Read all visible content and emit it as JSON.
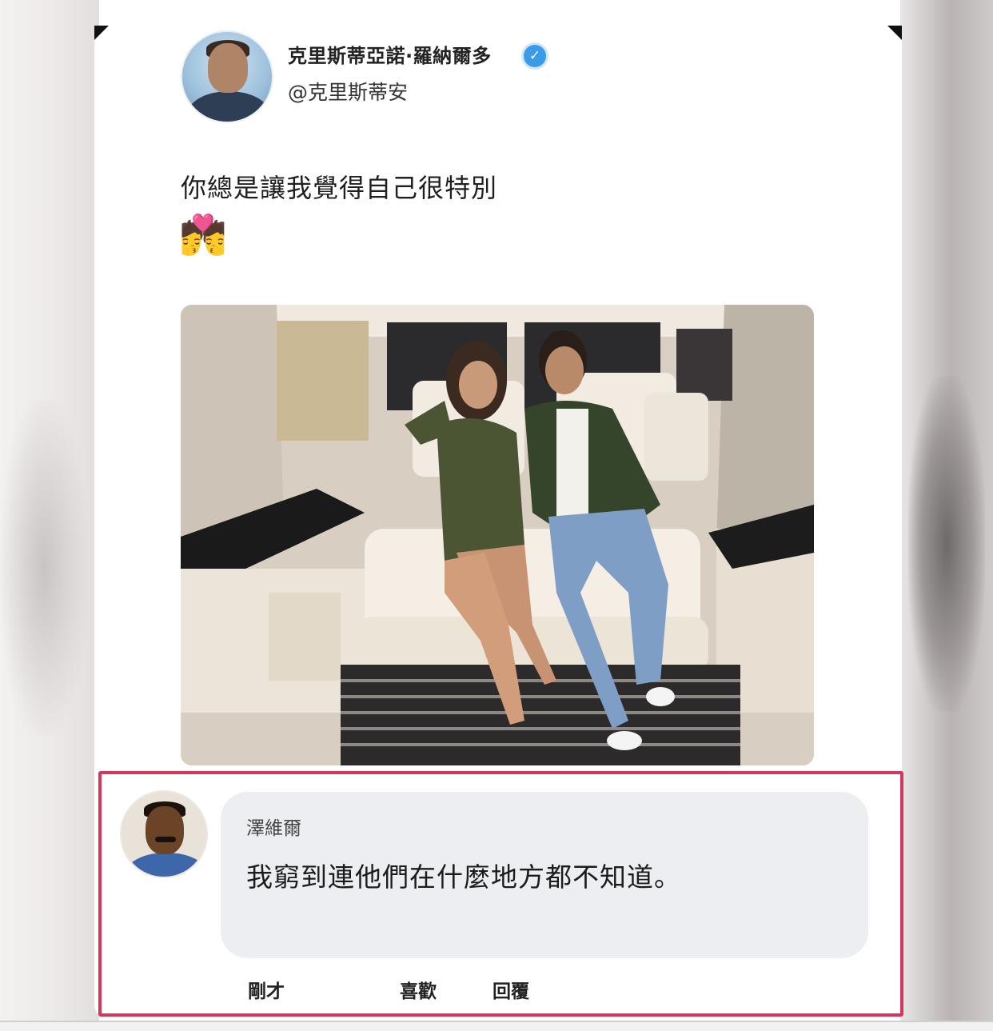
{
  "post": {
    "author_name": "克里斯蒂亞諾·羅納爾多",
    "author_handle": "@克里斯蒂安",
    "verified_icon": "✓",
    "text": "你總是讓我覺得自己很特別",
    "emoji": "💏",
    "avatar_icon": "profile-photo",
    "photo_icon": "couple-in-van-photo"
  },
  "comment": {
    "author_name": "澤維爾",
    "text": "我窮到連他們在什麼地方都不知道。",
    "timestamp": "剛才",
    "like_label": "喜歡",
    "reply_label": "回覆",
    "highlight_color": "#d4365c"
  },
  "colors": {
    "verified_badge": "#3a9be9",
    "bubble_bg": "#eceef1"
  }
}
